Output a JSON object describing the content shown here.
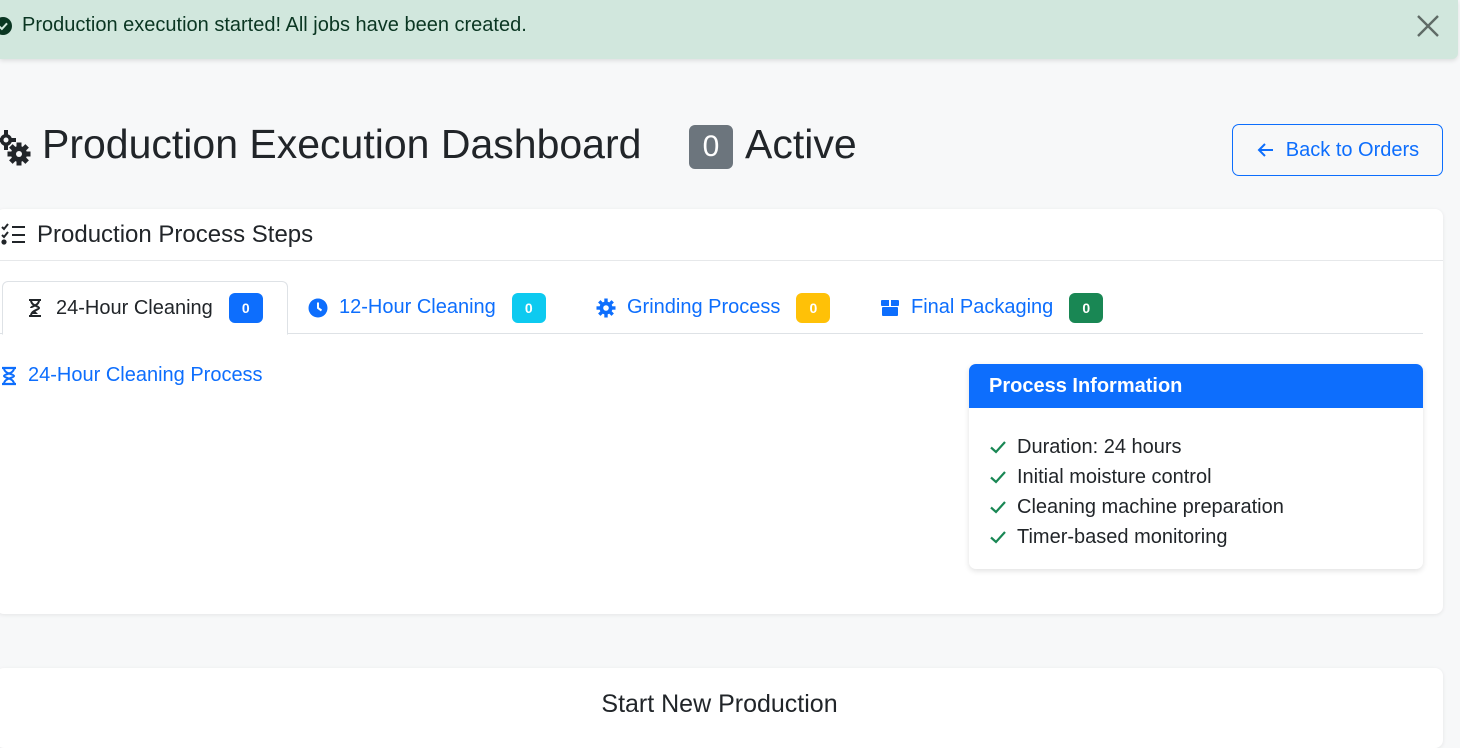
{
  "alert": {
    "message": "Production execution started! All jobs have been created.",
    "close_icon": "close-icon",
    "status_icon": "check-circle-icon"
  },
  "header": {
    "title": "Production Execution Dashboard",
    "active_count": "0",
    "active_label": "Active",
    "back_button": "Back to Orders"
  },
  "process_steps": {
    "title": "Production Process Steps",
    "tabs": [
      {
        "label": "24-Hour Cleaning",
        "count": "0",
        "badge_color": "#0d6efd",
        "icon": "hourglass-icon",
        "active": true
      },
      {
        "label": "12-Hour Cleaning",
        "count": "0",
        "badge_color": "#0dcaf0",
        "icon": "clock-icon",
        "active": false
      },
      {
        "label": "Grinding Process",
        "count": "0",
        "badge_color": "#ffc107",
        "icon": "gear-icon",
        "active": false
      },
      {
        "label": "Final Packaging",
        "count": "0",
        "badge_color": "#198754",
        "icon": "box-icon",
        "active": false
      }
    ],
    "panel_title": "24-Hour Cleaning Process",
    "info": {
      "header": "Process Information",
      "items": [
        "Duration: 24 hours",
        "Initial moisture control",
        "Cleaning machine preparation",
        "Timer-based monitoring"
      ]
    }
  },
  "start_new": {
    "title": "Start New Production"
  },
  "colors": {
    "primary": "#0d6efd",
    "success": "#198754",
    "alert_bg": "#d1e7dd"
  }
}
